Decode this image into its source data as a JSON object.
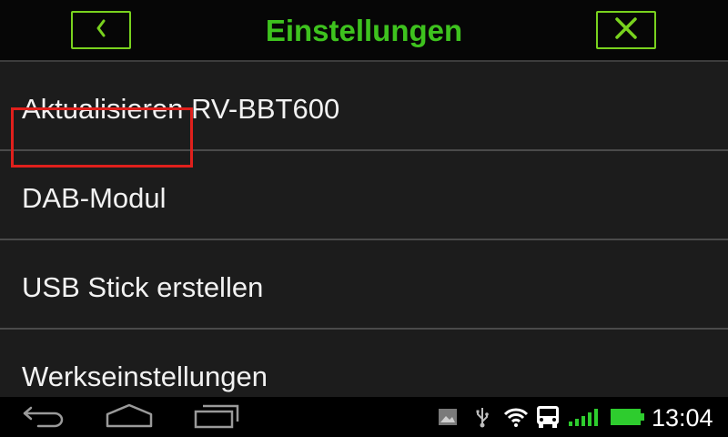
{
  "header": {
    "title": "Einstellungen",
    "back_icon": "chevron-left-icon",
    "close_icon": "close-icon",
    "accent_color": "#3ec21e"
  },
  "menu": {
    "items": [
      {
        "label": "Aktualisieren RV-BBT600"
      },
      {
        "label": "DAB-Modul",
        "highlighted": true
      },
      {
        "label": "USB Stick erstellen"
      },
      {
        "label": "Werkseinstellungen"
      }
    ],
    "highlight_color": "#e0201c"
  },
  "navbar": {
    "buttons": [
      "back-icon",
      "home-icon",
      "recent-apps-icon"
    ]
  },
  "status_bar": {
    "icons": [
      "image-notification-icon",
      "usb-icon",
      "wifi-icon",
      "bus-icon",
      "signal-icon",
      "battery-icon"
    ],
    "time": "13:04",
    "battery_color": "#2ecc2e",
    "signal_color": "#2ecc2e"
  }
}
